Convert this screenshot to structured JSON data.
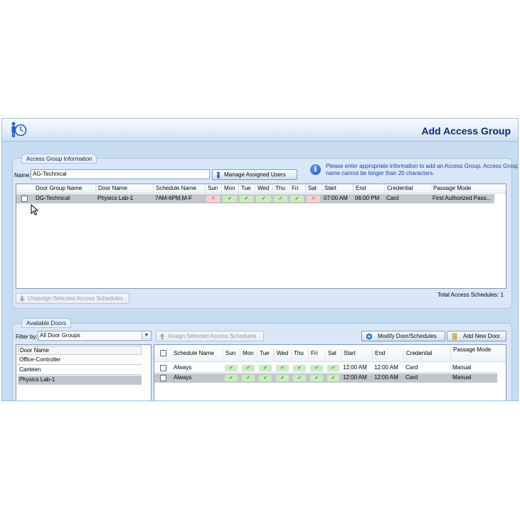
{
  "window": {
    "title": "Add Access Group"
  },
  "access_group_info": {
    "section_title": "Access Group Information",
    "name_label": "Name:",
    "name_value": "AG-Technical",
    "manage_users_button": "Manage Assigned Users",
    "info_text": "Please enter appropriate information to add an Access Group. Access Group name cannot be longer than 20 characters.",
    "unassign_button": "Unassign Selected Access Schedules",
    "total_label": "Total Access Schedules: 1"
  },
  "assigned_table": {
    "columns": [
      "Door Group Name",
      "Door Name",
      "Schedule Name",
      "Sun",
      "Mon",
      "Tue",
      "Wed",
      "Thu",
      "Fri",
      "Sat",
      "Start",
      "End",
      "Credential",
      "Passage Mode"
    ],
    "rows": [
      {
        "door_group": "DG-Technical",
        "door_name": "Physics Lab-1",
        "schedule": "7AM-6PM,M-F",
        "days": [
          "off",
          "on",
          "on",
          "on",
          "on",
          "on",
          "off"
        ],
        "start": "07:00 AM",
        "end": "06:00 PM",
        "credential": "Card",
        "passage_mode": "First Authorized Pass..."
      }
    ]
  },
  "available_doors": {
    "section_title": "Available Doors",
    "filter_label": "Filter by:",
    "filter_value": "All Door Groups",
    "assign_button": "Assign Selected Access Schedules",
    "modify_button": "Modify Door/Schedules",
    "add_door_button": "Add New Door",
    "door_list_header": "Door Name",
    "doors": [
      "Office-Controller",
      "Canteen",
      "Physics Lab-1"
    ],
    "schedule_columns": [
      "Schedule Name",
      "Sun",
      "Mon",
      "Tue",
      "Wed",
      "Thu",
      "Fri",
      "Sat",
      "Start",
      "End",
      "Credential",
      "Passage Mode"
    ],
    "schedules": [
      {
        "name": "Always",
        "start": "12:00 AM",
        "end": "12:00 AM",
        "credential": "Card",
        "passage_mode": "Manual"
      },
      {
        "name": "Always",
        "start": "12:00 AM",
        "end": "12:00 AM",
        "credential": "Card",
        "passage_mode": "Manual"
      }
    ]
  },
  "colors": {
    "accent": "#1540a8",
    "title": "#0f2c6a",
    "panel": "#c7dcf1",
    "check_on": "#3a9a2e",
    "check_off": "#d65a5a"
  },
  "icons": [
    "access-group-icon",
    "info-icon",
    "users-icon",
    "down-arrow-icon",
    "up-arrow-icon",
    "modify-icon",
    "add-door-icon",
    "mouse-cursor-icon"
  ]
}
